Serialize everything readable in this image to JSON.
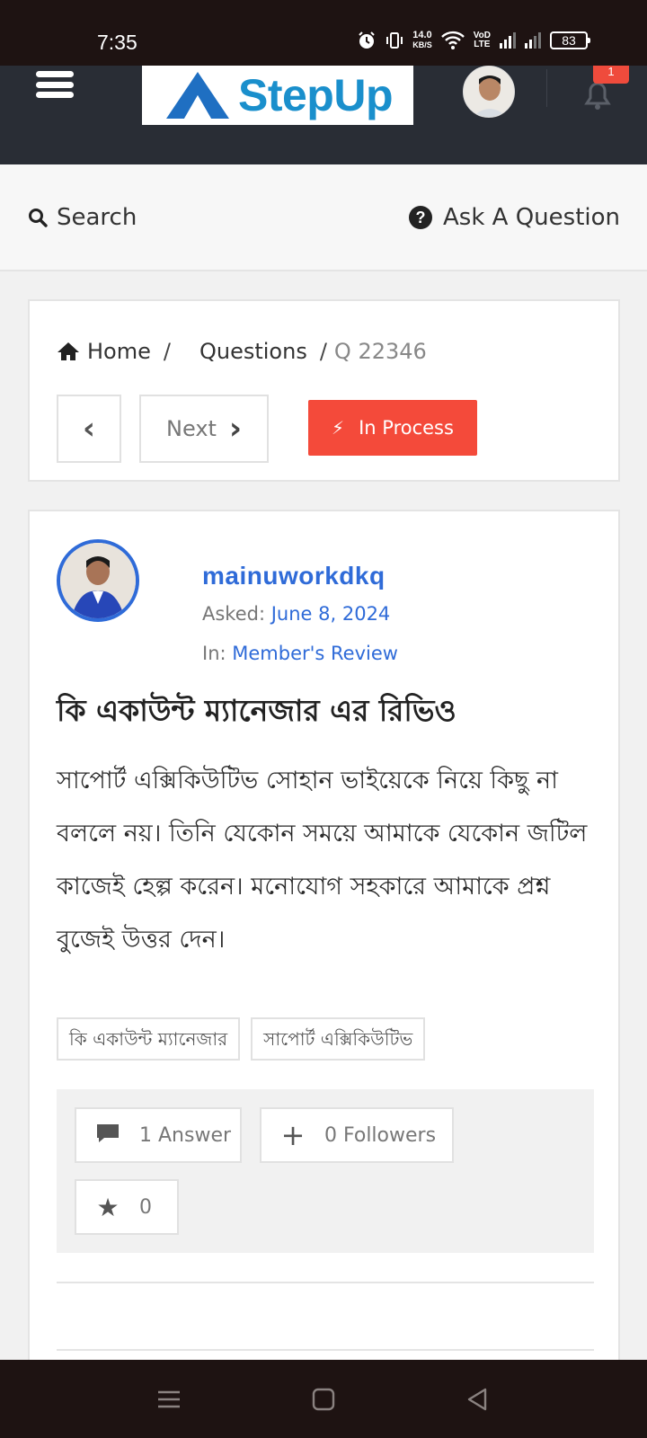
{
  "status_bar": {
    "time": "7:35",
    "speed_value": "14.0",
    "speed_unit": "KB/S",
    "network_top": "VoD",
    "network_bottom": "LTE",
    "battery": "83"
  },
  "header": {
    "logo_text": "StepUp",
    "notification_count": "1"
  },
  "search_bar": {
    "search_label": "Search",
    "ask_label": "Ask A Question",
    "ask_icon": "?"
  },
  "breadcrumb": {
    "home": "Home",
    "sep1": "/",
    "questions": "Questions",
    "sep2": "/",
    "current": "Q 22346"
  },
  "navigation": {
    "prev_icon": "‹",
    "next_label": "Next",
    "next_icon": "›",
    "status_label": "In Process",
    "status_icon": "⚡"
  },
  "question": {
    "author": "mainuworkdkq",
    "asked_label": "Asked:",
    "asked_date": "June 8, 2024",
    "in_label": "In:",
    "category": "Member's Review",
    "title": "কি একাউন্ট ম্যানেজার এর রিভিও",
    "body": "সাপোর্ট এক্সিকিউটিভ সোহান ভাইয়েকে নিয়ে কিছু না বললে নয়। তিনি যেকোন সময়ে আমাকে যেকোন জটিল কাজেই হেল্প করেন। মনোযোগ সহকারে আমাকে প্রশ্ন বুজেই উত্তর দেন।",
    "tags": [
      "কি একাউন্ট ম্যানেজার",
      "সাপোর্ট এক্সিকিউটিভ"
    ]
  },
  "stats": {
    "answers": "1 Answer",
    "followers_icon": "+",
    "followers": "0 Followers",
    "favorite_icon": "★",
    "favorites": "0"
  },
  "colors": {
    "header_bg": "#292d35",
    "accent_blue": "#2f6bd8",
    "status_red": "#f44a3a"
  }
}
